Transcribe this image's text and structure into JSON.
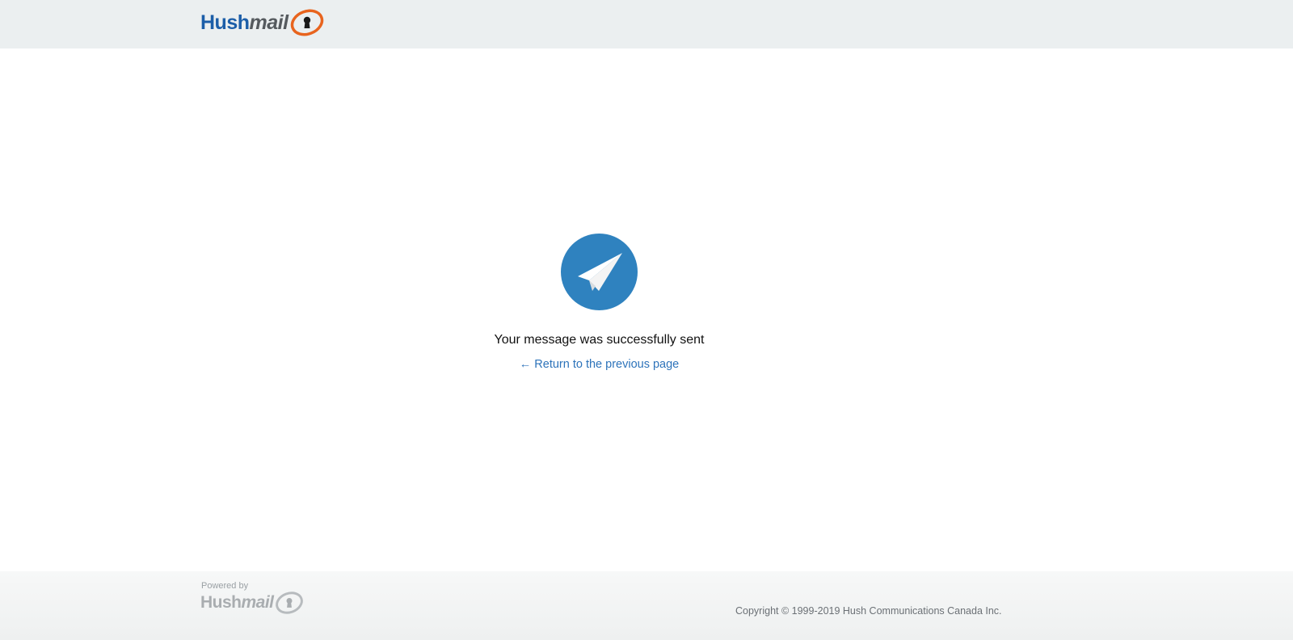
{
  "header": {
    "logo_hush": "Hush",
    "logo_mail": "mail"
  },
  "main": {
    "icon": "paper-plane-icon",
    "message": "Your message was successfully sent",
    "back_link": "← Return to the previous page"
  },
  "footer": {
    "powered_by": "Powered by",
    "logo_hush": "Hush",
    "logo_mail": "mail",
    "copyright": "Copyright © 1999-2019 Hush Communications Canada Inc."
  },
  "colors": {
    "brand_blue": "#1c5ea8",
    "brand_orange": "#e8641e",
    "icon_blue": "#2f82bf",
    "link": "#2d73ba"
  }
}
